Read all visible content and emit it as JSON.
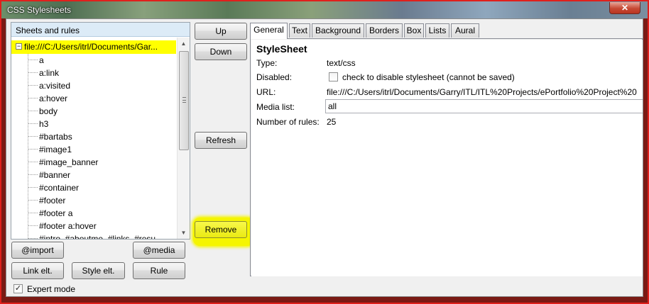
{
  "window": {
    "title": "CSS Stylesheets",
    "close_glyph": "✕"
  },
  "tree": {
    "header": "Sheets and rules",
    "root_label": "file:///C:/Users/itrl/Documents/Gar...",
    "items": [
      "a",
      "a:link",
      "a:visited",
      "a:hover",
      "body",
      "h3",
      "#bartabs",
      "#image1",
      "#image_banner",
      "#banner",
      "#container",
      "#footer",
      "#footer a",
      "#footer a:hover",
      "#intro, #aboutme, #links, #resu"
    ]
  },
  "buttons": {
    "up": "Up",
    "down": "Down",
    "refresh": "Refresh",
    "remove": "Remove",
    "import": "@import",
    "media": "@media",
    "link_elt": "Link elt.",
    "style_elt": "Style elt.",
    "rule": "Rule"
  },
  "expert_mode": {
    "label": "Expert mode",
    "checked": true,
    "check_glyph": "✓"
  },
  "tabs": [
    "General",
    "Text",
    "Background",
    "Borders",
    "Box",
    "Lists",
    "Aural"
  ],
  "active_tab": "General",
  "general": {
    "title": "StyleSheet",
    "type_label": "Type:",
    "type_value": "text/css",
    "disabled_label": "Disabled:",
    "disabled_text": "check to disable stylesheet (cannot be saved)",
    "disabled_checked": false,
    "url_label": "URL:",
    "url_value": "file:///C:/Users/itrl/Documents/Garry/ITL/ITL%20Projects/ePortfolio%20Project%20",
    "media_label": "Media list:",
    "media_value": "all",
    "rules_label": "Number of rules:",
    "rules_value": "25"
  },
  "colors": {
    "highlight": "#ffff00",
    "frame": "#e0201c",
    "tree_header_bg": "#dcebf7"
  }
}
